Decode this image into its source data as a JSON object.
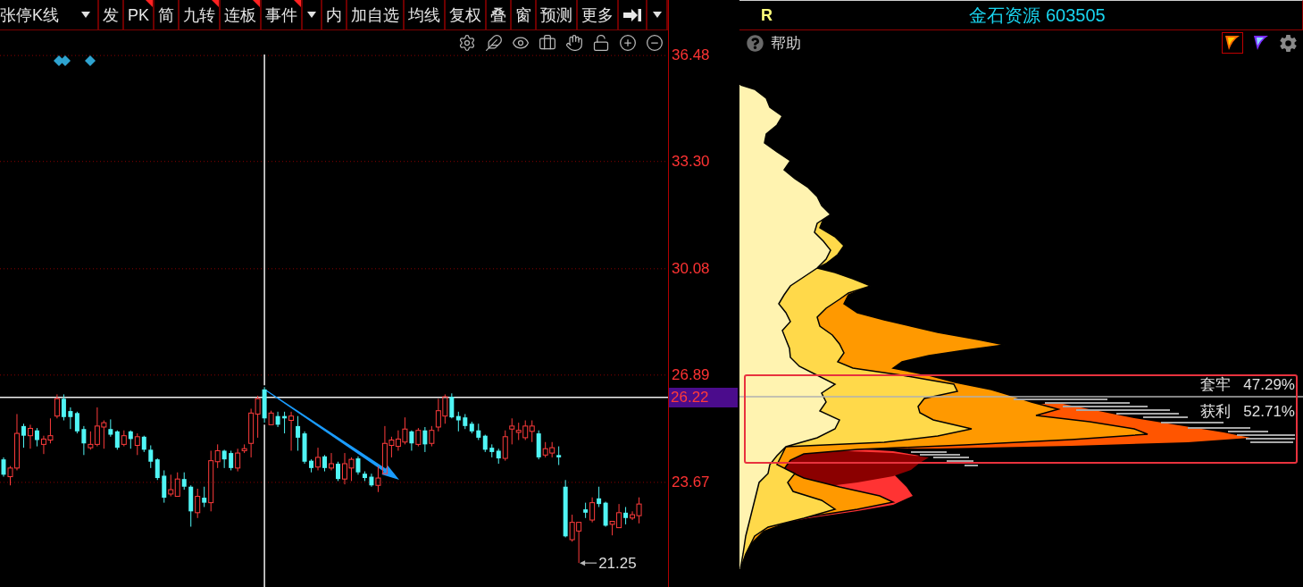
{
  "toolbar": {
    "items": [
      {
        "kind": "select",
        "label": "张停K线",
        "flagged": false
      },
      {
        "kind": "text",
        "label": "发",
        "flagged": false
      },
      {
        "kind": "text",
        "label": "PK",
        "flagged": true
      },
      {
        "kind": "text",
        "label": "简",
        "flagged": false
      },
      {
        "kind": "text",
        "label": "九转",
        "flagged": true
      },
      {
        "kind": "text",
        "label": "连板",
        "flagged": true
      },
      {
        "kind": "text",
        "label": "事件",
        "flagged": true
      },
      {
        "kind": "dropdown",
        "flagged": false
      },
      {
        "kind": "text",
        "label": "内",
        "flagged": false
      },
      {
        "kind": "text",
        "label": "加自选",
        "flagged": false
      },
      {
        "kind": "text",
        "label": "均线",
        "flagged": false
      },
      {
        "kind": "text",
        "label": "复权",
        "flagged": false
      },
      {
        "kind": "text",
        "label": "叠",
        "flagged": false
      },
      {
        "kind": "text",
        "label": "窗",
        "flagged": false
      },
      {
        "kind": "text",
        "label": "预测",
        "flagged": false
      },
      {
        "kind": "text",
        "label": "更多",
        "flagged": false
      },
      {
        "kind": "icon",
        "flagged": false
      },
      {
        "kind": "dropdown",
        "flagged": false
      }
    ]
  },
  "chart": {
    "chart_data": {
      "type": "candlestick",
      "ohlc": [
        [
          24.36,
          24.42,
          23.84,
          23.9
        ],
        [
          23.84,
          24.16,
          23.58,
          24.1
        ],
        [
          24.1,
          25.72,
          24.03,
          25.14
        ],
        [
          25.36,
          25.43,
          24.71,
          25.07
        ],
        [
          25.07,
          25.4,
          24.68,
          25.29
        ],
        [
          25.23,
          25.3,
          24.75,
          24.94
        ],
        [
          24.81,
          25.07,
          24.52,
          24.97
        ],
        [
          24.94,
          25.59,
          24.84,
          25.07
        ],
        [
          25.66,
          26.31,
          25.59,
          26.18
        ],
        [
          26.18,
          26.31,
          25.53,
          25.63
        ],
        [
          25.81,
          25.92,
          25.27,
          25.63
        ],
        [
          25.75,
          25.79,
          25.14,
          25.2
        ],
        [
          25.27,
          25.36,
          24.49,
          24.84
        ],
        [
          24.71,
          25.2,
          24.65,
          24.81
        ],
        [
          24.81,
          25.92,
          24.75,
          25.36
        ],
        [
          25.33,
          25.53,
          24.68,
          25.46
        ],
        [
          25.27,
          25.56,
          25.04,
          25.1
        ],
        [
          25.2,
          25.23,
          24.65,
          24.71
        ],
        [
          24.81,
          25.23,
          24.75,
          25.07
        ],
        [
          25.2,
          25.23,
          24.68,
          24.97
        ],
        [
          24.78,
          25.14,
          24.49,
          25.04
        ],
        [
          25.04,
          25.07,
          24.58,
          24.65
        ],
        [
          24.65,
          24.78,
          24.1,
          24.29
        ],
        [
          24.36,
          24.39,
          23.74,
          23.8
        ],
        [
          23.87,
          24.03,
          23.06,
          23.21
        ],
        [
          23.32,
          23.9,
          23.25,
          23.45
        ],
        [
          23.25,
          23.97,
          23.22,
          23.77
        ],
        [
          23.77,
          23.97,
          23.45,
          23.54
        ],
        [
          23.54,
          23.58,
          22.34,
          22.8
        ],
        [
          22.76,
          23.48,
          22.6,
          23.25
        ],
        [
          23.21,
          23.54,
          22.93,
          23.06
        ],
        [
          23.06,
          24.62,
          22.8,
          24.32
        ],
        [
          24.29,
          24.81,
          24.1,
          24.62
        ],
        [
          24.62,
          24.65,
          24.1,
          24.36
        ],
        [
          24.55,
          24.62,
          24.03,
          24.1
        ],
        [
          24.1,
          24.68,
          24.0,
          24.55
        ],
        [
          24.62,
          24.81,
          24.55,
          24.68
        ],
        [
          24.84,
          25.88,
          24.42,
          25.75
        ],
        [
          25.72,
          26.27,
          25.01,
          26.18
        ],
        [
          26.46,
          26.53,
          25.46,
          25.59
        ],
        [
          25.4,
          25.82,
          25.36,
          25.75
        ],
        [
          25.66,
          25.79,
          25.33,
          25.4
        ],
        [
          25.66,
          25.79,
          25.14,
          25.59
        ],
        [
          25.53,
          25.79,
          24.62,
          25.66
        ],
        [
          25.36,
          25.66,
          24.62,
          25.01
        ],
        [
          25.14,
          25.2,
          24.23,
          24.29
        ],
        [
          24.32,
          24.36,
          23.97,
          24.1
        ],
        [
          24.13,
          24.71,
          24.03,
          24.42
        ],
        [
          24.45,
          24.49,
          24.0,
          24.1
        ],
        [
          24.1,
          24.55,
          24.03,
          24.23
        ],
        [
          24.23,
          24.29,
          23.71,
          23.77
        ],
        [
          23.77,
          24.55,
          23.61,
          24.23
        ],
        [
          24.1,
          24.42,
          23.71,
          24.36
        ],
        [
          24.39,
          24.45,
          23.9,
          23.97
        ],
        [
          23.93,
          24.0,
          23.71,
          23.8
        ],
        [
          23.84,
          23.93,
          23.54,
          23.58
        ],
        [
          23.58,
          24.16,
          23.38,
          23.8
        ],
        [
          23.93,
          25.36,
          23.9,
          24.84
        ],
        [
          24.78,
          25.04,
          24.42,
          24.94
        ],
        [
          24.75,
          25.23,
          24.62,
          24.97
        ],
        [
          24.88,
          25.62,
          24.81,
          25.27
        ],
        [
          25.2,
          25.23,
          24.62,
          24.84
        ],
        [
          24.81,
          25.3,
          24.75,
          25.23
        ],
        [
          25.23,
          25.33,
          24.58,
          24.81
        ],
        [
          24.84,
          25.36,
          24.75,
          25.23
        ],
        [
          25.33,
          26.18,
          25.2,
          25.82
        ],
        [
          25.66,
          26.31,
          25.43,
          26.24
        ],
        [
          26.24,
          26.34,
          25.59,
          25.62
        ],
        [
          25.66,
          25.79,
          25.2,
          25.53
        ],
        [
          25.62,
          25.72,
          25.27,
          25.36
        ],
        [
          25.43,
          25.49,
          25.14,
          25.2
        ],
        [
          25.23,
          25.43,
          24.94,
          25.01
        ],
        [
          25.07,
          25.1,
          24.58,
          24.65
        ],
        [
          24.71,
          24.81,
          24.42,
          24.58
        ],
        [
          24.62,
          24.68,
          24.23,
          24.39
        ],
        [
          24.39,
          25.23,
          24.32,
          25.04
        ],
        [
          25.27,
          25.59,
          24.81,
          25.36
        ],
        [
          25.17,
          25.46,
          24.94,
          25.23
        ],
        [
          25.01,
          25.53,
          24.94,
          25.36
        ],
        [
          25.2,
          25.53,
          24.88,
          25.36
        ],
        [
          25.14,
          25.23,
          24.36,
          24.42
        ],
        [
          24.49,
          24.88,
          24.42,
          24.68
        ],
        [
          24.55,
          24.88,
          24.42,
          24.71
        ],
        [
          24.49,
          24.75,
          24.19,
          24.42
        ],
        [
          23.54,
          23.74,
          22.02,
          22.05
        ],
        [
          21.95,
          22.7,
          21.89,
          22.47
        ],
        [
          22.21,
          22.5,
          21.25,
          22.47
        ],
        [
          22.86,
          23.06,
          22.6,
          22.76
        ],
        [
          22.54,
          23.22,
          22.47,
          23.06
        ],
        [
          23.19,
          23.54,
          22.93,
          23.02
        ],
        [
          23.06,
          23.09,
          22.34,
          22.37
        ],
        [
          22.41,
          22.54,
          22.08,
          22.5
        ],
        [
          22.31,
          23.02,
          22.28,
          22.76
        ],
        [
          22.76,
          22.93,
          22.41,
          22.6
        ],
        [
          22.6,
          22.8,
          22.54,
          22.7
        ],
        [
          22.67,
          23.22,
          22.44,
          23.02
        ]
      ],
      "ylim": [
        20.53,
        36.51
      ],
      "yticks": [
        {
          "value": 36.48,
          "label": "36.48"
        },
        {
          "value": 33.3,
          "label": "33.30"
        },
        {
          "value": 30.08,
          "label": "30.08"
        },
        {
          "value": 26.89,
          "label": "26.89"
        },
        {
          "value": 23.67,
          "label": "23.67"
        }
      ],
      "grid": true,
      "ref_lines": [
        {
          "axis": "y",
          "value": 26.22,
          "label": "26.22"
        }
      ],
      "annotations": [
        "21.25"
      ]
    }
  },
  "chip_panel": {
    "badge": "R",
    "title": "金石资源 603505",
    "help": "帮助",
    "modes": [
      {
        "kind": "warm",
        "selected": true
      },
      {
        "kind": "cool",
        "selected": false
      }
    ],
    "stats": [
      {
        "label": "套牢",
        "value": "47.29%"
      },
      {
        "label": "获利",
        "value": "52.71%"
      }
    ]
  }
}
